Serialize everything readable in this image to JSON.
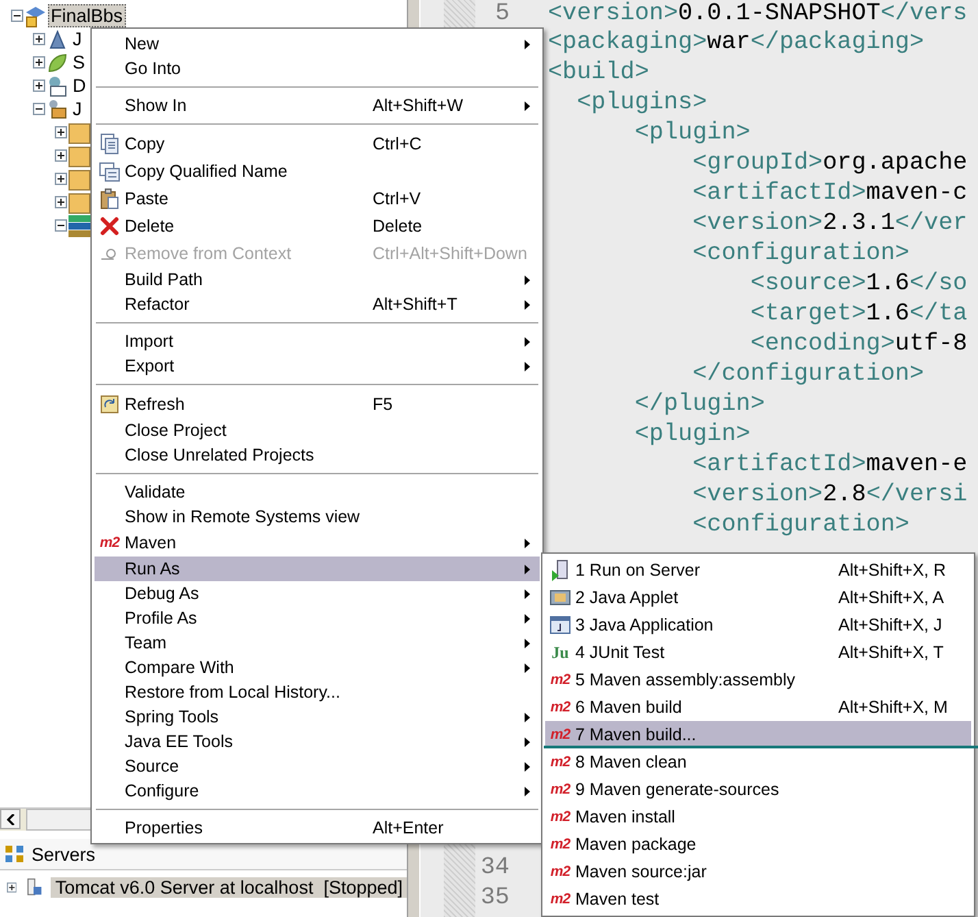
{
  "project_explorer": {
    "tree": [
      {
        "label": "FinalBbs",
        "selected": true,
        "expanded": true,
        "children": [
          {
            "label": "J",
            "selected": false,
            "expanded": false
          },
          {
            "label": "S",
            "selected": false,
            "expanded": false
          },
          {
            "label": "D",
            "selected": false,
            "expanded": false
          },
          {
            "label": "J",
            "selected": false,
            "expanded": true,
            "children": [
              {
                "expanded": false
              },
              {
                "expanded": false
              },
              {
                "expanded": false
              },
              {
                "expanded": false
              },
              {
                "expanded": true
              }
            ]
          }
        ]
      }
    ]
  },
  "servers_view": {
    "tab": "Servers",
    "rows": [
      {
        "label": "Tomcat v6.0 Server at localhost  [Stopped]",
        "selected": true,
        "expanded": false
      }
    ]
  },
  "editor": {
    "lines": [
      {
        "number": "5",
        "code": "<version>0.0.1-SNAPSHOT</vers"
      },
      {
        "code": "<packaging>war</packaging>"
      },
      {
        "code": "<build>"
      },
      {
        "code": "  <plugins>"
      },
      {
        "code": "      <plugin>"
      },
      {
        "code": "          <groupId>org.apache"
      },
      {
        "code": "          <artifactId>maven-c"
      },
      {
        "code": "          <version>2.3.1</ver"
      },
      {
        "code": "          <configuration>"
      },
      {
        "code": "              <source>1.6</so"
      },
      {
        "code": "              <target>1.6</ta"
      },
      {
        "code": "              <encoding>utf-8"
      },
      {
        "code": "          </configuration>"
      },
      {
        "code": "      </plugin>"
      },
      {
        "code": "      <plugin>"
      },
      {
        "code": "          <artifactId>maven-e"
      },
      {
        "code": "          <version>2.8</versi"
      },
      {
        "code": "          <configuration>"
      }
    ],
    "bottom_line_numbers": [
      "34",
      "35"
    ]
  },
  "context_menu": {
    "groups": [
      [
        {
          "label": "New",
          "submenu": true,
          "selected": false,
          "disabled": false
        },
        {
          "label": "Go Into",
          "submenu": false,
          "selected": false,
          "disabled": false
        }
      ],
      [
        {
          "label": "Show In",
          "shortcut": "Alt+Shift+W",
          "submenu": true,
          "selected": false,
          "disabled": false
        }
      ],
      [
        {
          "label": "Copy",
          "shortcut": "Ctrl+C",
          "submenu": false,
          "selected": false,
          "disabled": false
        },
        {
          "label": "Copy Qualified Name",
          "submenu": false,
          "selected": false,
          "disabled": false
        },
        {
          "label": "Paste",
          "shortcut": "Ctrl+V",
          "submenu": false,
          "selected": false,
          "disabled": false
        },
        {
          "label": "Delete",
          "shortcut": "Delete",
          "submenu": false,
          "selected": false,
          "disabled": false
        },
        {
          "label": "Remove from Context",
          "shortcut": "Ctrl+Alt+Shift+Down",
          "submenu": false,
          "selected": false,
          "disabled": true
        },
        {
          "label": "Build Path",
          "submenu": true,
          "selected": false,
          "disabled": false
        },
        {
          "label": "Refactor",
          "shortcut": "Alt+Shift+T",
          "submenu": true,
          "selected": false,
          "disabled": false
        }
      ],
      [
        {
          "label": "Import",
          "submenu": true,
          "selected": false,
          "disabled": false
        },
        {
          "label": "Export",
          "submenu": true,
          "selected": false,
          "disabled": false
        }
      ],
      [
        {
          "label": "Refresh",
          "shortcut": "F5",
          "submenu": false,
          "selected": false,
          "disabled": false
        },
        {
          "label": "Close Project",
          "submenu": false,
          "selected": false,
          "disabled": false
        },
        {
          "label": "Close Unrelated Projects",
          "submenu": false,
          "selected": false,
          "disabled": false
        }
      ],
      [
        {
          "label": "Validate",
          "submenu": false,
          "selected": false,
          "disabled": false
        },
        {
          "label": "Show in Remote Systems view",
          "submenu": false,
          "selected": false,
          "disabled": false
        },
        {
          "label": "Maven",
          "icon_text": "m2",
          "submenu": true,
          "selected": false,
          "disabled": false
        },
        {
          "label": "Run As",
          "submenu": true,
          "selected": true,
          "disabled": false
        },
        {
          "label": "Debug As",
          "submenu": true,
          "selected": false,
          "disabled": false
        },
        {
          "label": "Profile As",
          "submenu": true,
          "selected": false,
          "disabled": false
        },
        {
          "label": "Team",
          "submenu": true,
          "selected": false,
          "disabled": false
        },
        {
          "label": "Compare With",
          "submenu": true,
          "selected": false,
          "disabled": false
        },
        {
          "label": "Restore from Local History...",
          "submenu": false,
          "selected": false,
          "disabled": false
        },
        {
          "label": "Spring Tools",
          "submenu": true,
          "selected": false,
          "disabled": false
        },
        {
          "label": "Java EE Tools",
          "submenu": true,
          "selected": false,
          "disabled": false
        },
        {
          "label": "Source",
          "submenu": true,
          "selected": false,
          "disabled": false
        },
        {
          "label": "Configure",
          "submenu": true,
          "selected": false,
          "disabled": false
        }
      ],
      [
        {
          "label": "Properties",
          "shortcut": "Alt+Enter",
          "submenu": false,
          "selected": false,
          "disabled": false
        }
      ]
    ]
  },
  "run_as_menu": {
    "groups": [
      [
        {
          "label": "1 Run on Server",
          "shortcut": "Alt+Shift+X, R",
          "selected": false
        },
        {
          "label": "2 Java Applet",
          "shortcut": "Alt+Shift+X, A",
          "selected": false
        },
        {
          "label": "3 Java Application",
          "shortcut": "Alt+Shift+X, J",
          "selected": false
        },
        {
          "label": "4 JUnit Test",
          "shortcut": "Alt+Shift+X, T",
          "icon_text": "Ju",
          "selected": false
        },
        {
          "label": "5 Maven assembly:assembly",
          "icon_text": "m2",
          "selected": false
        },
        {
          "label": "6 Maven build",
          "shortcut": "Alt+Shift+X, M",
          "icon_text": "m2",
          "selected": false
        },
        {
          "label": "7 Maven build...",
          "icon_text": "m2",
          "selected": true
        },
        {
          "label": "8 Maven clean",
          "icon_text": "m2",
          "selected": false
        },
        {
          "label": "9 Maven generate-sources",
          "icon_text": "m2",
          "selected": false
        },
        {
          "label": "Maven install",
          "icon_text": "m2",
          "selected": false
        },
        {
          "label": "Maven package",
          "icon_text": "m2",
          "selected": false
        },
        {
          "label": "Maven source:jar",
          "icon_text": "m2",
          "selected": false
        },
        {
          "label": "Maven test",
          "icon_text": "m2",
          "selected": false
        }
      ]
    ]
  }
}
